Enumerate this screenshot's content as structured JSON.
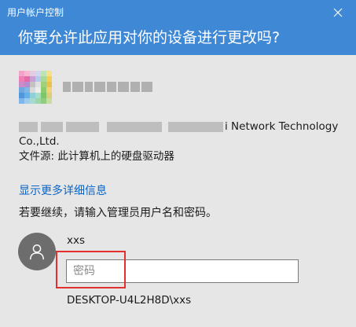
{
  "window": {
    "title": "用户帐户控制",
    "question": "你要允许此应用对你的设备进行更改吗?"
  },
  "app": {
    "icon": "blurred-app-icon",
    "publisher_visible": "i Network Technology",
    "publisher_line2": "Co.,Ltd.",
    "file_source": "文件源: 此计算机上的硬盘驱动器"
  },
  "details_link": "显示更多详细信息",
  "continue_prompt": "若要继续，请输入管理员用户名和密码。",
  "credentials": {
    "username": "xxs",
    "password_placeholder": "密码",
    "domain": "DESKTOP-U4L2H8D\\xxs"
  },
  "colors": {
    "header": "#3f88d6",
    "body": "#e6e6e6",
    "link": "#0a64c8",
    "highlight": "#e03030"
  }
}
